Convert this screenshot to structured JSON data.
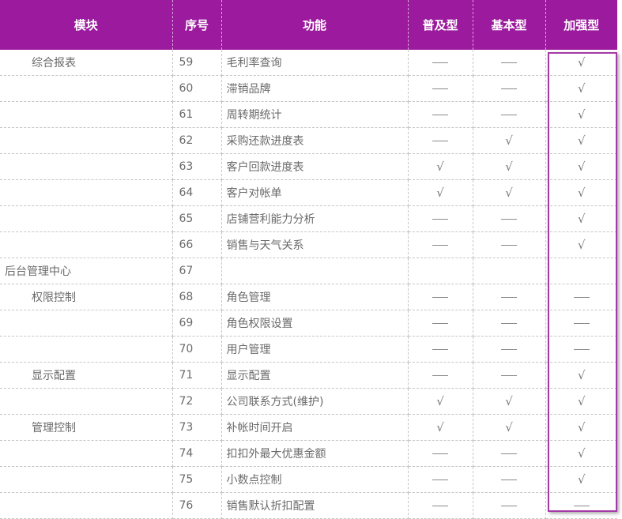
{
  "headers": [
    "模块",
    "序号",
    "功能",
    "普及型",
    "基本型",
    "加强型"
  ],
  "rows": [
    {
      "module": "综合报表",
      "no": "59",
      "func": "毛利率查询",
      "a": "dash",
      "b": "dash",
      "c": "check"
    },
    {
      "module": "",
      "no": "60",
      "func": "滞销品牌",
      "a": "dash",
      "b": "dash",
      "c": "check"
    },
    {
      "module": "",
      "no": "61",
      "func": "周转期统计",
      "a": "dash",
      "b": "dash",
      "c": "check"
    },
    {
      "module": "",
      "no": "62",
      "func": "采购还款进度表",
      "a": "dash",
      "b": "check",
      "c": "check"
    },
    {
      "module": "",
      "no": "63",
      "func": "客户回款进度表",
      "a": "check",
      "b": "check",
      "c": "check"
    },
    {
      "module": "",
      "no": "64",
      "func": "客户对帐单",
      "a": "check",
      "b": "check",
      "c": "check"
    },
    {
      "module": "",
      "no": "65",
      "func": "店铺营利能力分析",
      "a": "dash",
      "b": "dash",
      "c": "check"
    },
    {
      "module": "",
      "no": "66",
      "func": "销售与天气关系",
      "a": "dash",
      "b": "dash",
      "c": "check"
    },
    {
      "module": "后台管理中心",
      "no": "67",
      "func": "",
      "a": "",
      "b": "",
      "c": "",
      "top": true
    },
    {
      "module": "权限控制",
      "no": "68",
      "func": "角色管理",
      "a": "dash",
      "b": "dash",
      "c": "dash"
    },
    {
      "module": "",
      "no": "69",
      "func": "角色权限设置",
      "a": "dash",
      "b": "dash",
      "c": "dash"
    },
    {
      "module": "",
      "no": "70",
      "func": "用户管理",
      "a": "dash",
      "b": "dash",
      "c": "dash"
    },
    {
      "module": "显示配置",
      "no": "71",
      "func": "显示配置",
      "a": "dash",
      "b": "dash",
      "c": "check"
    },
    {
      "module": "",
      "no": "72",
      "func": "公司联系方式(维护)",
      "a": "check",
      "b": "check",
      "c": "check"
    },
    {
      "module": "管理控制",
      "no": "73",
      "func": "补帐时间开启",
      "a": "check",
      "b": "check",
      "c": "check"
    },
    {
      "module": "",
      "no": "74",
      "func": "扣扣外最大优惠金额",
      "a": "dash",
      "b": "dash",
      "c": "check"
    },
    {
      "module": "",
      "no": "75",
      "func": "小数点控制",
      "a": "dash",
      "b": "dash",
      "c": "check"
    },
    {
      "module": "",
      "no": "76",
      "func": "销售默认折扣配置",
      "a": "dash",
      "b": "dash",
      "c": "dash"
    }
  ],
  "marks": {
    "check": "√",
    "dash": ""
  },
  "highlight_color": "#a43aa6",
  "header_color": "#9b1a9d"
}
